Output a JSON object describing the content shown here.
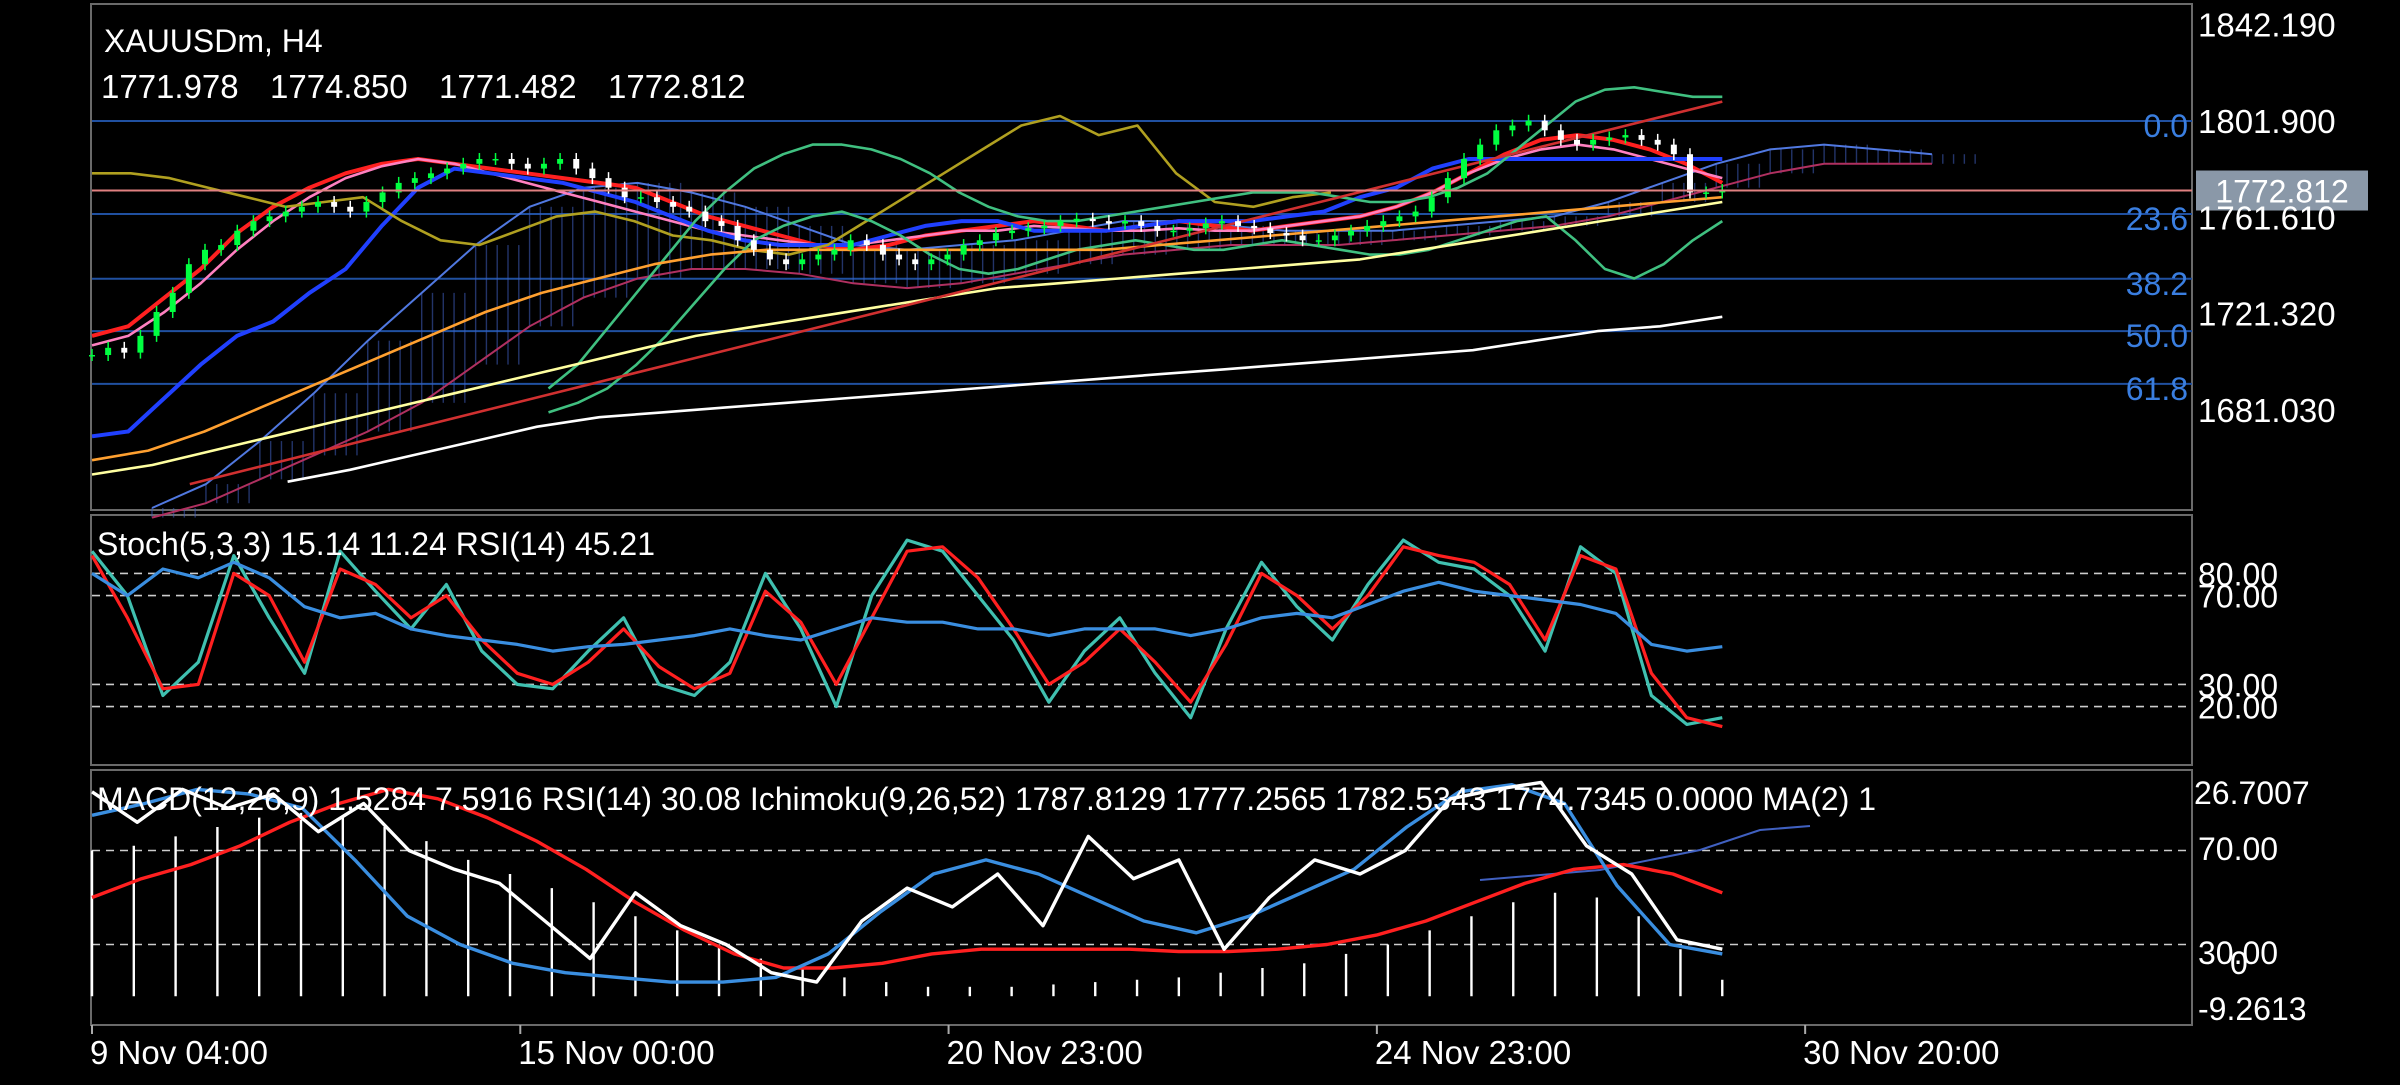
{
  "chart_data": [
    {
      "type": "line",
      "panel": "price",
      "symbol_title": "XAUUSDm, H4",
      "ohlc": {
        "open": "1771.978",
        "high": "1774.850",
        "low": "1771.482",
        "close": "1772.812"
      },
      "ylim": [
        1640,
        1850
      ],
      "y_ticks": [
        "1842.190",
        "1801.900",
        "1761.610",
        "1721.320",
        "1681.030"
      ],
      "current_price": "1772.812",
      "fib_levels": [
        {
          "label": "0.0",
          "value": 1801.9
        },
        {
          "label": "23.6",
          "value": 1763.0
        },
        {
          "label": "38.2",
          "value": 1735.9
        },
        {
          "label": "50.0",
          "value": 1714.0
        },
        {
          "label": "61.8",
          "value": 1691.9
        }
      ],
      "x_labels": [
        "9 Nov 04:00",
        "15 Nov 00:00",
        "20 Nov 23:00",
        "24 Nov 23:00",
        "30 Nov 20:00"
      ],
      "x_label_index": [
        0,
        31,
        62,
        93,
        124
      ],
      "n_bars": 152,
      "future_bars": 34,
      "candles_close": [
        1704,
        1707,
        1705,
        1712,
        1722,
        1730,
        1742,
        1748,
        1750,
        1756,
        1760,
        1762,
        1764,
        1766,
        1768,
        1766,
        1764,
        1768,
        1772,
        1776,
        1778,
        1780,
        1782,
        1784,
        1786,
        1786,
        1784,
        1782,
        1784,
        1786,
        1782,
        1778,
        1774,
        1770,
        1770,
        1768,
        1766,
        1764,
        1760,
        1758,
        1752,
        1748,
        1744,
        1742,
        1744,
        1746,
        1748,
        1752,
        1750,
        1746,
        1744,
        1742,
        1744,
        1746,
        1750,
        1752,
        1755,
        1756,
        1757,
        1758,
        1760,
        1761,
        1760,
        1759,
        1760,
        1758,
        1756,
        1756,
        1757,
        1759,
        1760,
        1758,
        1757,
        1755,
        1754,
        1752,
        1752,
        1754,
        1756,
        1758,
        1760,
        1762,
        1764,
        1770,
        1778,
        1786,
        1792,
        1798,
        1800,
        1802,
        1798,
        1794,
        1792,
        1794,
        1795,
        1796,
        1794,
        1792,
        1788,
        1772,
        1772,
        1773
      ],
      "series": [
        {
          "name": "",
          "color": "#ff2020",
          "values": [
            1712,
            1716,
            1728,
            1740,
            1755,
            1766,
            1774,
            1780,
            1784,
            1786,
            1784,
            1782,
            1780,
            1778,
            1776,
            1774,
            1768,
            1762,
            1758,
            1754,
            1750,
            1748,
            1750,
            1754,
            1756,
            1758,
            1760,
            1758,
            1756,
            1758,
            1760,
            1758,
            1756,
            1758,
            1760,
            1762,
            1766,
            1772,
            1780,
            1788,
            1794,
            1796,
            1794,
            1790,
            1784,
            1776
          ]
        },
        {
          "name": "",
          "color": "#ff80c0",
          "values": [
            1708,
            1712,
            1722,
            1734,
            1748,
            1760,
            1770,
            1778,
            1783,
            1786,
            1784,
            1780,
            1776,
            1772,
            1768,
            1764,
            1760,
            1756,
            1754,
            1752,
            1750,
            1750,
            1752,
            1754,
            1756,
            1756,
            1758,
            1757,
            1756,
            1756,
            1757,
            1756,
            1756,
            1758,
            1760,
            1762,
            1766,
            1772,
            1780,
            1786,
            1790,
            1792,
            1790,
            1786,
            1782,
            1778
          ]
        },
        {
          "name": "",
          "color": "#2040ff",
          "values": [
            1670,
            1672,
            1686,
            1700,
            1712,
            1718,
            1730,
            1740,
            1758,
            1774,
            1782,
            1780,
            1778,
            1776,
            1772,
            1768,
            1762,
            1756,
            1752,
            1750,
            1750,
            1750,
            1754,
            1758,
            1760,
            1760,
            1756,
            1756,
            1756,
            1758,
            1760,
            1760,
            1760,
            1762,
            1764,
            1770,
            1774,
            1782,
            1786,
            1786,
            1786,
            1786,
            1786,
            1786,
            1786,
            1786
          ]
        },
        {
          "name": "",
          "color": "#b0a020",
          "values": [
            1780,
            1780,
            1778,
            1774,
            1770,
            1766,
            1768,
            1770,
            1760,
            1752,
            1750,
            1756,
            1762,
            1764,
            1760,
            1754,
            1752,
            1748,
            1746,
            1750,
            1760,
            1770,
            1780,
            1790,
            1800,
            1804,
            1796,
            1800,
            1780,
            1768,
            1766,
            1770,
            1772
          ]
        },
        {
          "name": "",
          "color": "#40c080",
          "values": [
            1690,
            1700,
            1715,
            1730,
            1745,
            1760,
            1772,
            1782,
            1788,
            1792,
            1792,
            1790,
            1786,
            1780,
            1772,
            1766,
            1762,
            1760,
            1760,
            1762,
            1764,
            1766,
            1768,
            1770,
            1772,
            1772,
            1772,
            1770,
            1768,
            1768,
            1770,
            1774,
            1780,
            1790,
            1800,
            1810,
            1815,
            1816,
            1814,
            1812,
            1812
          ]
        },
        {
          "name": "",
          "color": "#40c080",
          "values": [
            1680,
            1684,
            1690,
            1700,
            1712,
            1726,
            1740,
            1752,
            1758,
            1762,
            1764,
            1760,
            1754,
            1746,
            1740,
            1738,
            1740,
            1744,
            1748,
            1750,
            1752,
            1750,
            1748,
            1748,
            1750,
            1752,
            1750,
            1748,
            1746,
            1746,
            1748,
            1752,
            1756,
            1760,
            1762,
            1752,
            1740,
            1736,
            1742,
            1752,
            1760
          ]
        },
        {
          "name": "",
          "color": "#ffa030",
          "values": [
            1660,
            1664,
            1672,
            1682,
            1692,
            1702,
            1712,
            1722,
            1730,
            1736,
            1742,
            1746,
            1748,
            1748,
            1748,
            1748,
            1748,
            1748,
            1748,
            1750,
            1752,
            1754,
            1756,
            1758,
            1760,
            1762,
            1764,
            1766,
            1768,
            1770
          ]
        },
        {
          "name": "",
          "color": "#ffffa0",
          "values": [
            1654,
            1658,
            1664,
            1670,
            1676,
            1682,
            1688,
            1694,
            1700,
            1706,
            1712,
            1716,
            1720,
            1724,
            1728,
            1732,
            1734,
            1736,
            1738,
            1740,
            1742,
            1744,
            1748,
            1752,
            1756,
            1760,
            1764,
            1768
          ]
        },
        {
          "name": "",
          "color": "#ffffff",
          "values": [
            1651,
            1656,
            1662,
            1668,
            1674,
            1678,
            1680,
            1682,
            1684,
            1686,
            1688,
            1690,
            1692,
            1694,
            1696,
            1698,
            1700,
            1702,
            1704,
            1706,
            1710,
            1714,
            1716,
            1720
          ]
        },
        {
          "name": "",
          "color": "#d03030",
          "values": [
            1650,
            1660,
            1670,
            1680,
            1690,
            1700,
            1710,
            1720,
            1730,
            1740,
            1750,
            1760,
            1770,
            1780,
            1790,
            1800,
            1810
          ]
        }
      ],
      "cloud_upper": [
        1640,
        1650,
        1668,
        1688,
        1710,
        1730,
        1750,
        1766,
        1774,
        1776,
        1772,
        1766,
        1758,
        1750,
        1748,
        1750,
        1752,
        1756,
        1760,
        1760,
        1758,
        1756,
        1756,
        1756,
        1758,
        1760,
        1762,
        1768,
        1776,
        1784,
        1790,
        1792,
        1790,
        1788
      ],
      "cloud_lower": [
        1636,
        1642,
        1652,
        1662,
        1672,
        1684,
        1700,
        1716,
        1728,
        1736,
        1740,
        1740,
        1738,
        1734,
        1732,
        1734,
        1738,
        1742,
        1746,
        1748,
        1750,
        1750,
        1750,
        1752,
        1754,
        1756,
        1758,
        1762,
        1768,
        1774,
        1780,
        1784,
        1784,
        1784
      ],
      "colors": {
        "up_candle": "#00ff40",
        "down_candle": "#ffffff",
        "fib_line": "#2050a0",
        "fib_text": "#3a7ee0",
        "price_line": "#e08080"
      }
    },
    {
      "type": "line",
      "panel": "stochastic",
      "title": "Stoch(5,3,3) 15.14 11.24 RSI(14) 45.21",
      "ylim": [
        0,
        100
      ],
      "y_ticks": [
        "80.00",
        "70.00",
        "30.00",
        "20.00"
      ],
      "levels": [
        80,
        70,
        30,
        20
      ],
      "series": [
        {
          "name": "",
          "color": "#40c0b0",
          "values": [
            90,
            70,
            25,
            40,
            88,
            60,
            35,
            90,
            72,
            55,
            75,
            45,
            30,
            28,
            45,
            60,
            30,
            25,
            40,
            80,
            55,
            20,
            70,
            95,
            90,
            70,
            50,
            22,
            45,
            60,
            35,
            15,
            55,
            85,
            65,
            50,
            75,
            95,
            85,
            82,
            70,
            45,
            92,
            80,
            25,
            12,
            15
          ]
        },
        {
          "name": "",
          "color": "#ff2020",
          "values": [
            88,
            60,
            28,
            30,
            80,
            70,
            40,
            82,
            75,
            60,
            70,
            50,
            35,
            30,
            40,
            55,
            38,
            28,
            35,
            72,
            58,
            30,
            60,
            90,
            92,
            78,
            55,
            30,
            40,
            55,
            40,
            22,
            48,
            80,
            70,
            55,
            70,
            92,
            88,
            85,
            75,
            50,
            88,
            82,
            35,
            15,
            11
          ]
        },
        {
          "name": "",
          "color": "#3a8ee0",
          "values": [
            80,
            70,
            82,
            78,
            85,
            78,
            65,
            60,
            62,
            55,
            52,
            50,
            48,
            45,
            47,
            48,
            50,
            52,
            55,
            52,
            50,
            55,
            60,
            58,
            58,
            55,
            55,
            52,
            55,
            55,
            55,
            52,
            55,
            60,
            62,
            60,
            66,
            72,
            76,
            72,
            70,
            68,
            66,
            62,
            48,
            45,
            47
          ]
        }
      ]
    },
    {
      "type": "line",
      "panel": "macd",
      "title": "MACD(12,26,9) 1.5284 7.5916 RSI(14) 30.08 Ichimoku(9,26,52) 1787.8129 1777.2565 1782.5343 1774.7345 0.0000 MA(2) 1",
      "ylim": [
        0,
        100
      ],
      "y_ticks": [
        "26.7007",
        "70.00",
        "30.00",
        "0",
        "-9.2613"
      ],
      "levels": [
        70,
        30
      ],
      "histogram": [
        70,
        72,
        76,
        80,
        84,
        86,
        84,
        80,
        74,
        66,
        60,
        54,
        48,
        42,
        36,
        30,
        24,
        20,
        16,
        14,
        12,
        12,
        12,
        13,
        14,
        15,
        16,
        18,
        20,
        22,
        26,
        30,
        36,
        42,
        48,
        52,
        50,
        42,
        28,
        15
      ],
      "series": [
        {
          "name": "",
          "color": "#ff2020",
          "values": [
            50,
            58,
            64,
            72,
            82,
            90,
            96,
            92,
            84,
            74,
            62,
            48,
            36,
            26,
            20,
            20,
            22,
            26,
            28,
            28,
            28,
            28,
            27,
            27,
            28,
            30,
            34,
            40,
            48,
            56,
            62,
            64,
            60,
            52
          ]
        },
        {
          "name": "",
          "color": "#3a8ee0",
          "values": [
            85,
            90,
            96,
            94,
            88,
            66,
            42,
            30,
            22,
            18,
            16,
            14,
            14,
            16,
            26,
            44,
            60,
            66,
            60,
            50,
            40,
            35,
            42,
            52,
            62,
            80,
            95,
            98,
            90,
            55,
            30,
            26
          ]
        },
        {
          "name": "",
          "color": "#ffffff",
          "values": [
            95,
            82,
            96,
            88,
            94,
            78,
            90,
            70,
            62,
            56,
            40,
            24,
            52,
            38,
            30,
            18,
            14,
            40,
            54,
            46,
            60,
            38,
            76,
            58,
            66,
            28,
            50,
            66,
            60,
            70,
            92,
            96,
            99,
            72,
            60,
            32,
            28
          ]
        }
      ],
      "colors": {
        "histogram": "#ffffff",
        "level_line": "#cccccc"
      }
    }
  ]
}
